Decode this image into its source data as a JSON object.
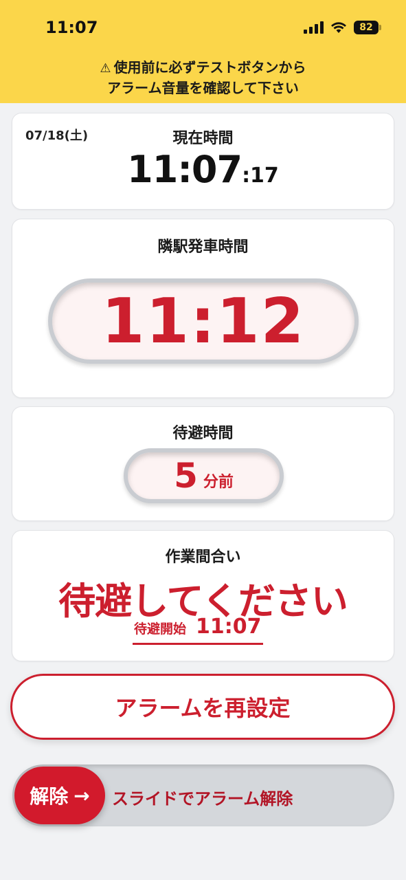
{
  "status_bar": {
    "time": "11:07",
    "battery": "82"
  },
  "banner": {
    "warning_line1": "使用前に必ずテストボタンから",
    "warning_line2": "アラーム音量を確認して下さい"
  },
  "current": {
    "date": "07/18(土)",
    "title": "現在時間",
    "time_hm": "11:07",
    "time_sec": ":17"
  },
  "departure": {
    "title": "隣駅発車時間",
    "time": "11:12"
  },
  "wait": {
    "title": "待避時間",
    "minutes": "5",
    "unit": "分前"
  },
  "work": {
    "title": "作業間合い",
    "message": "待避してください",
    "start_label": "待避開始",
    "start_time": "11:07"
  },
  "reset_button": {
    "label": "アラームを再設定"
  },
  "slider": {
    "knob_label": "解除",
    "arrow": "→",
    "hint": "スライドでアラーム解除"
  },
  "colors": {
    "accent_red": "#cc1f2e",
    "banner_yellow": "#fbd64a"
  }
}
